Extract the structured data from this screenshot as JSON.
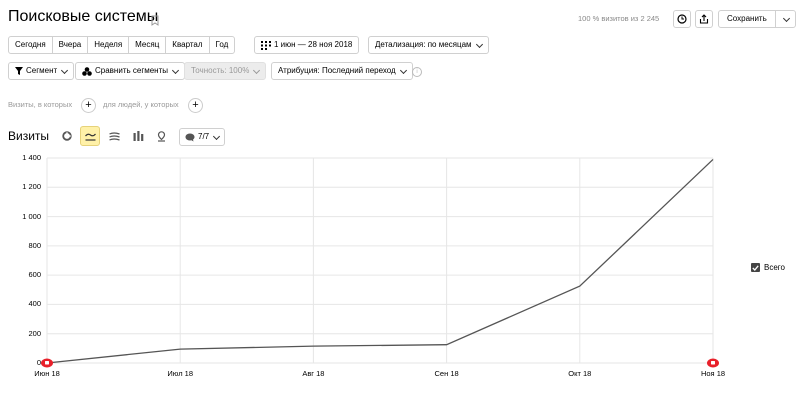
{
  "header": {
    "title": "Поисковые системы",
    "visits_summary": "100 % визитов из 2 245",
    "save_label": "Сохранить"
  },
  "periods": [
    "Сегодня",
    "Вчера",
    "Неделя",
    "Месяц",
    "Квартал",
    "Год"
  ],
  "date_range": "1 июн — 28 ноя 2018",
  "detail_label": "Детализация: по месяцам",
  "toolbar2": {
    "segment_label": "Сегмент",
    "compare_label": "Сравнить сегменты",
    "accuracy_label": "Точность: 100%",
    "attribution_label": "Атрибуция: Последний переход"
  },
  "filters": {
    "visits_where": "Визиты, в которых",
    "people_where": "для людей, у которых"
  },
  "chart_header": {
    "title": "Визиты",
    "metrics_count": "7/7"
  },
  "legend": {
    "label": "Всего",
    "checked": true
  },
  "colors": {
    "accent": "#fff1a8",
    "line": "#555555",
    "marker": "#e8202a"
  },
  "chart_data": {
    "type": "line",
    "categories": [
      "Июн 18",
      "Июл 18",
      "Авг 18",
      "Сен 18",
      "Окт 18",
      "Ноя 18"
    ],
    "series": [
      {
        "name": "Всего",
        "values": [
          0,
          95,
          115,
          125,
          525,
          1390
        ]
      }
    ],
    "ylim": [
      0,
      1400
    ],
    "yticks": [
      "0",
      "200",
      "400",
      "600",
      "800",
      "1 000",
      "1 200",
      "1 400"
    ],
    "grid": true,
    "legend": "right"
  }
}
